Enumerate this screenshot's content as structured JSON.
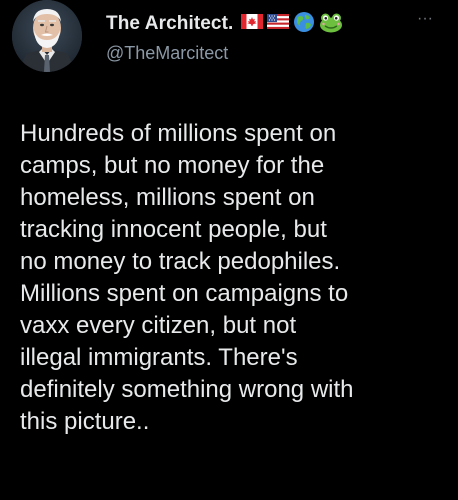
{
  "author": {
    "display_name": "The Architect.",
    "handle": "@TheMarcitect",
    "badges": [
      "canada-flag-icon",
      "us-flag-icon",
      "globe-icon",
      "frog-icon"
    ]
  },
  "more_menu_label": "···",
  "tweet_lines": [
    "Hundreds of millions spent on",
    "camps, but no money for the",
    "homeless, millions spent on",
    "tracking innocent people, but",
    "no money to track pedophiles.",
    "Millions spent on campaigns to",
    "vaxx every citizen, but not",
    "illegal immigrants. There's",
    "definitely something wrong with",
    "this picture.."
  ],
  "colors": {
    "background": "#000000",
    "text_primary": "#e7e9ea",
    "text_secondary": "#8b98a5"
  }
}
